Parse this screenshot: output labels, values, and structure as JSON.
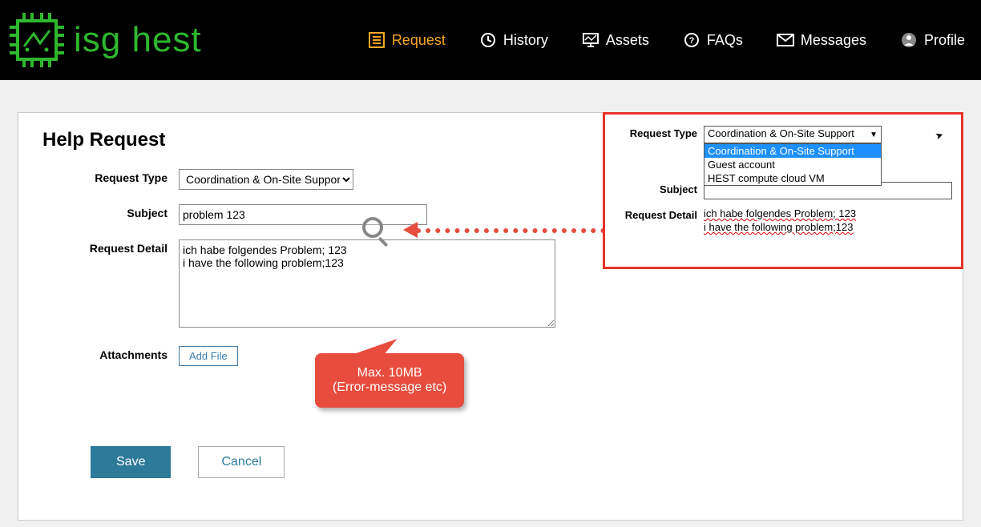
{
  "brand": {
    "name": "isg hest"
  },
  "nav": {
    "request": "Request",
    "history": "History",
    "assets": "Assets",
    "faqs": "FAQs",
    "messages": "Messages",
    "profile": "Profile"
  },
  "form": {
    "title": "Help Request",
    "labels": {
      "request_type": "Request Type",
      "subject": "Subject",
      "request_detail": "Request Detail",
      "attachments": "Attachments"
    },
    "request_type_value": "Coordination & On-Site Support",
    "subject_value": "problem 123",
    "detail_value": "ich habe folgendes Problem; 123\ni have the following problem;123",
    "add_file_label": "Add File",
    "save_label": "Save",
    "cancel_label": "Cancel"
  },
  "callout": {
    "line1": "Max. 10MB",
    "line2": "(Error-message etc)"
  },
  "inset": {
    "request_type_selected": "Coordination & On-Site Support",
    "options": {
      "o0": "Coordination & On-Site Support",
      "o1": "Guest account",
      "o2": "HEST compute cloud VM"
    },
    "detail_line1": "ich habe folgendes Problem; 123",
    "detail_line2": "i have the following problem;123"
  }
}
